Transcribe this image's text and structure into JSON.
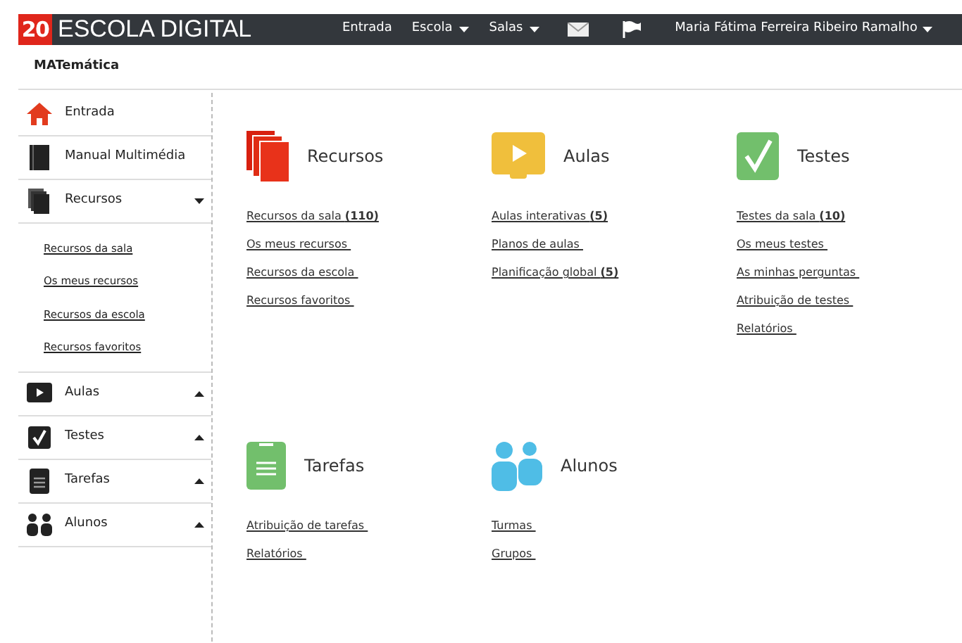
{
  "header": {
    "logo_number": "20",
    "logo_text": "ESCOLA DIGITAL",
    "nav": [
      {
        "label": "Entrada",
        "dropdown": false
      },
      {
        "label": "Escola",
        "dropdown": true
      },
      {
        "label": "Salas",
        "dropdown": true
      }
    ],
    "user": "Maria Fátima Ferreira Ribeiro Ramalho"
  },
  "subheader": {
    "title": "MATemática"
  },
  "sidebar": {
    "items": [
      {
        "label": "Entrada"
      },
      {
        "label": "Manual Multimédia"
      },
      {
        "label": "Recursos",
        "expanded": true,
        "children": [
          "Recursos da sala",
          "Os meus recursos",
          "Recursos da escola",
          "Recursos favoritos"
        ]
      },
      {
        "label": "Aulas",
        "expanded": false
      },
      {
        "label": "Testes",
        "expanded": false
      },
      {
        "label": "Tarefas",
        "expanded": false
      },
      {
        "label": "Alunos",
        "expanded": false
      }
    ]
  },
  "sections": [
    {
      "title": "Recursos",
      "links": [
        "Recursos da sala **(110)**",
        "Os meus recursos ",
        "Recursos da escola ",
        "Recursos favoritos "
      ]
    },
    {
      "title": "Aulas",
      "links": [
        "Aulas interativas **(5)**",
        "Planos de aulas ",
        "Planificação global **(5)**"
      ]
    },
    {
      "title": "Testes",
      "links": [
        "Testes da sala **(10)**",
        "Os meus testes ",
        "As minhas perguntas ",
        "Atribuição de testes ",
        "Relatórios "
      ]
    },
    {
      "title": "Tarefas",
      "links": [
        "Atribuição de tarefas ",
        "Relatórios "
      ]
    },
    {
      "title": "Alunos",
      "links": [
        "Turmas ",
        "Grupos "
      ]
    }
  ]
}
